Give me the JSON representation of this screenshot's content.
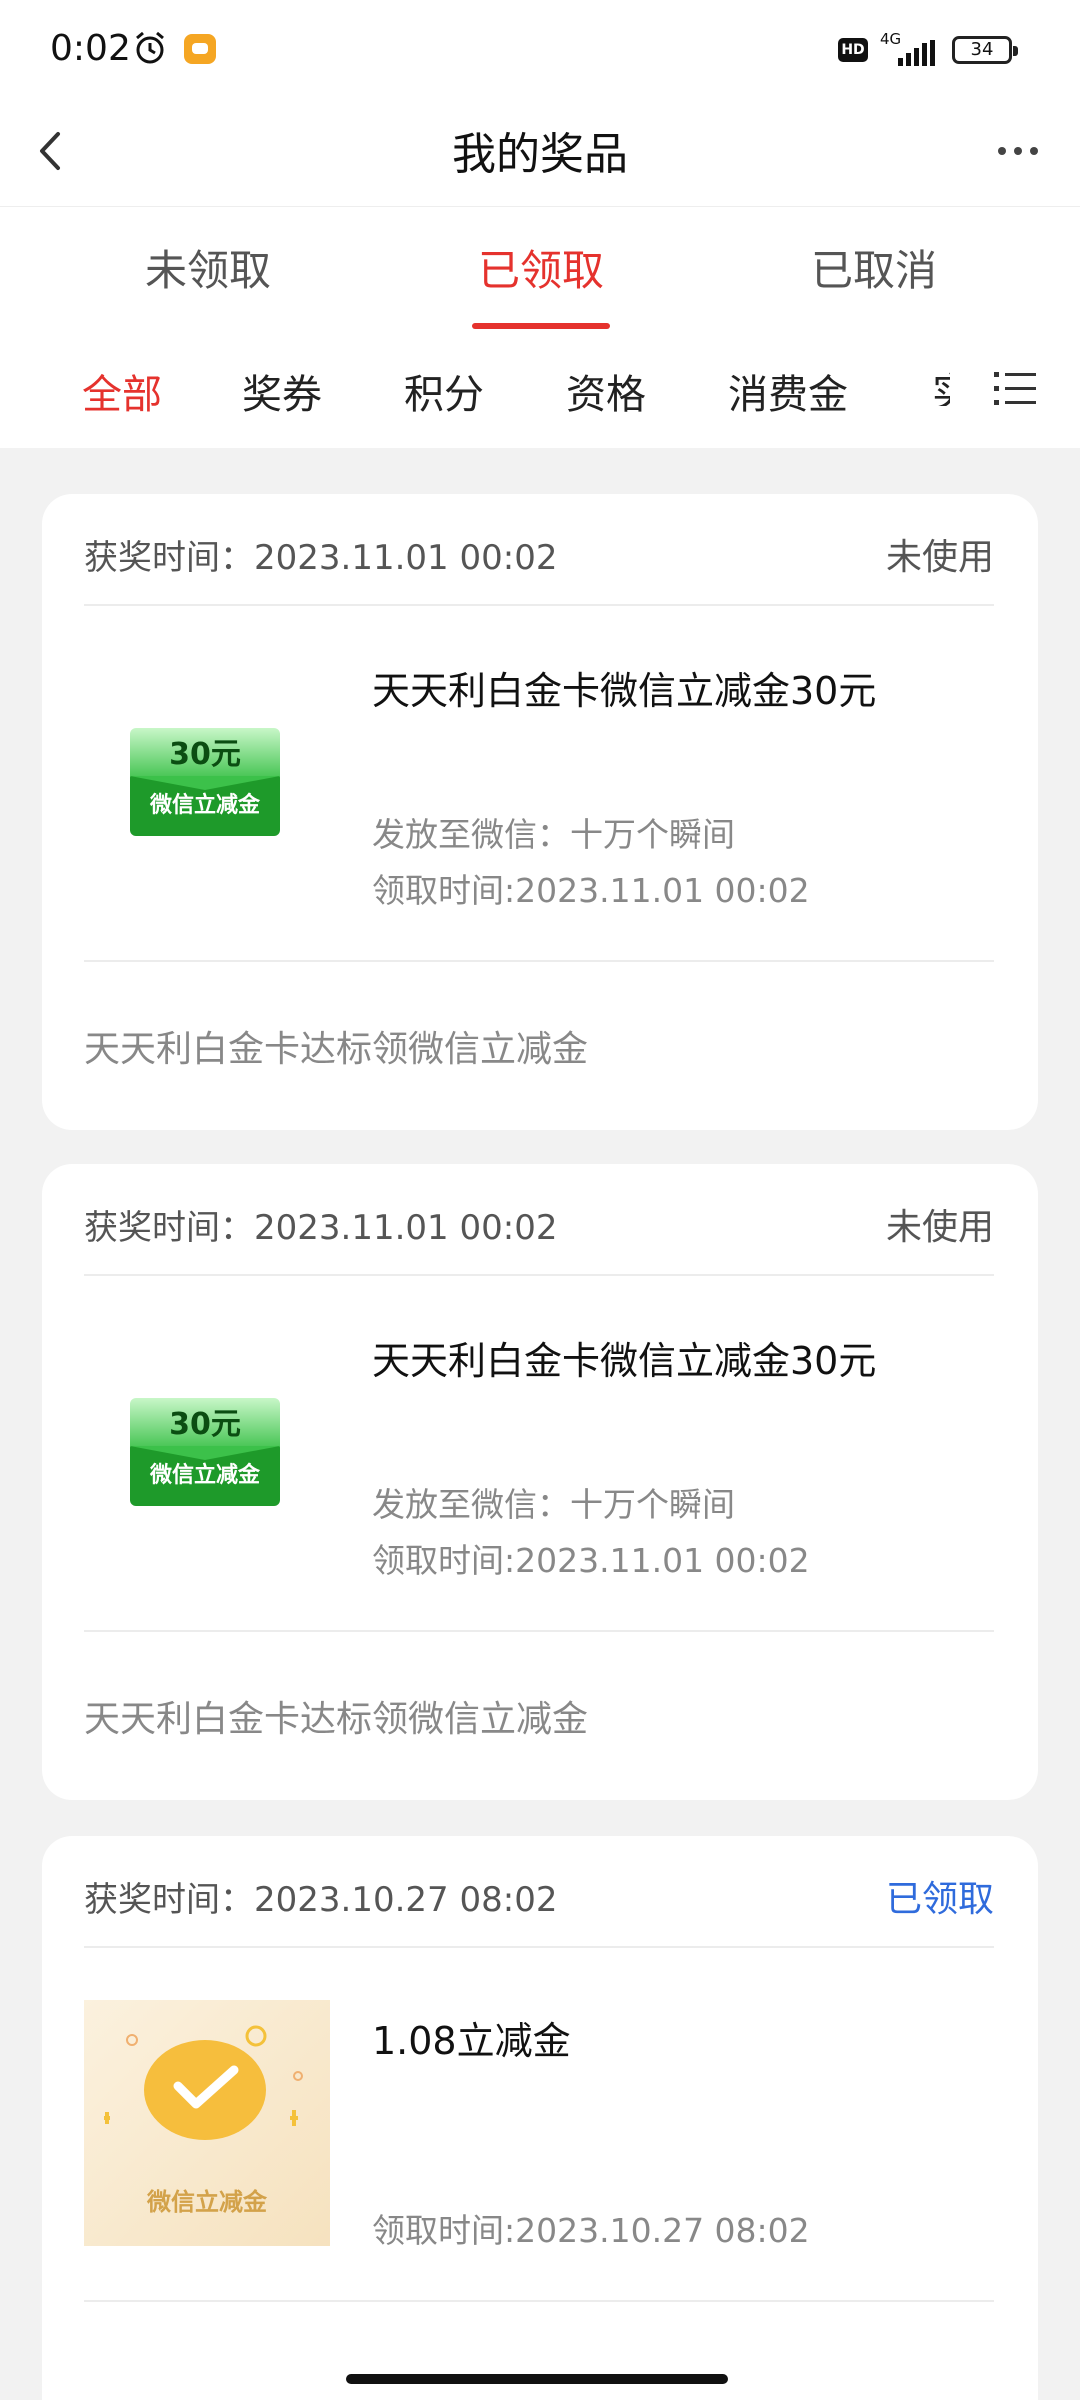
{
  "status_bar": {
    "time": "0:02",
    "network": "4G",
    "battery": "34"
  },
  "navbar": {
    "title": "我的奖品"
  },
  "tabs": [
    {
      "label": "未领取",
      "active": false
    },
    {
      "label": "已领取",
      "active": true
    },
    {
      "label": "已取消",
      "active": false
    }
  ],
  "filters": [
    {
      "label": "全部",
      "active": true
    },
    {
      "label": "奖券",
      "active": false
    },
    {
      "label": "积分",
      "active": false
    },
    {
      "label": "资格",
      "active": false
    },
    {
      "label": "消费金",
      "active": false
    }
  ],
  "filter_overflow": "实",
  "cards": [
    {
      "award_time": "获奖时间：2023.11.01 00:02",
      "status": "未使用",
      "name": "天天利白金卡微信立减金30元",
      "delivery": "发放至微信：十万个瞬间",
      "claim_time": "领取时间:2023.11.01 00:02",
      "footer": "天天利白金卡达标领微信立减金",
      "coupon_amount": "30元",
      "coupon_label": "微信立减金"
    },
    {
      "award_time": "获奖时间：2023.11.01 00:02",
      "status": "未使用",
      "name": "天天利白金卡微信立减金30元",
      "delivery": "发放至微信：十万个瞬间",
      "claim_time": "领取时间:2023.11.01 00:02",
      "footer": "天天利白金卡达标领微信立减金",
      "coupon_amount": "30元",
      "coupon_label": "微信立减金"
    },
    {
      "award_time": "获奖时间：2023.10.27 08:02",
      "status": "已领取",
      "name": "1.08立减金",
      "claim_time": "领取时间:2023.10.27 08:02",
      "image_label": "微信立减金"
    }
  ],
  "colors": {
    "accent": "#e5322d",
    "claimed": "#2f6bdc",
    "coupon_green": "#1e9a2a",
    "background": "#f2f2f2"
  }
}
